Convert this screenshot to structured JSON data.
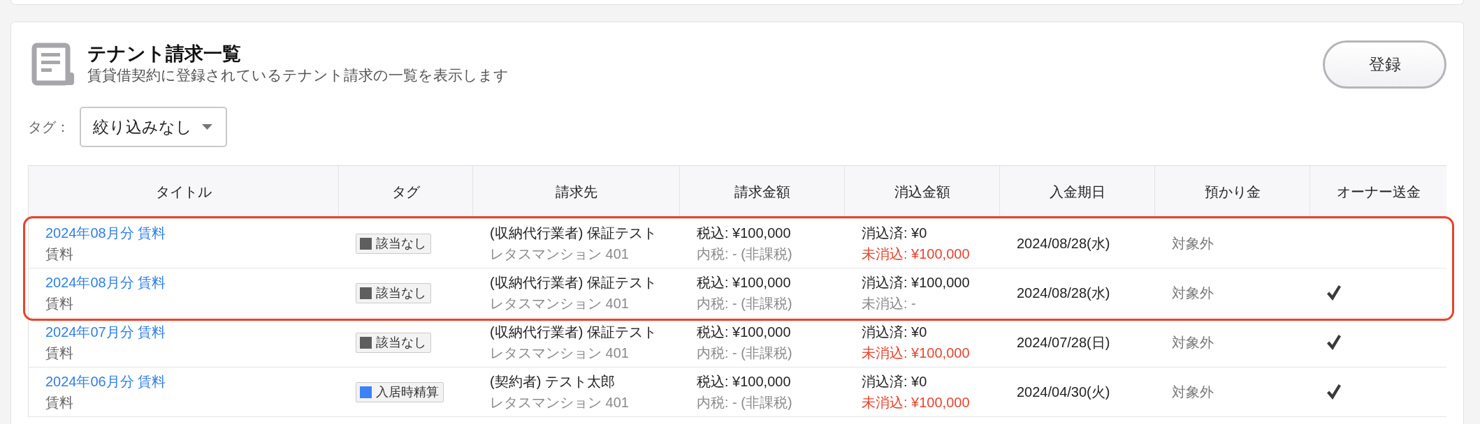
{
  "header": {
    "title": "テナント請求一覧",
    "subtitle": "賃貸借契約に登録されているテナント請求の一覧を表示します",
    "register_button": "登録"
  },
  "filter": {
    "label": "タグ：",
    "value": "絞り込みなし"
  },
  "table": {
    "columns": [
      "タイトル",
      "タグ",
      "請求先",
      "請求金額",
      "消込金額",
      "入金期日",
      "預かり金",
      "オーナー送金"
    ],
    "rows": [
      {
        "title": "2024年08月分 賃料",
        "category": "賃料",
        "tag": {
          "label": "該当なし",
          "color": "#5e5e5e"
        },
        "billing_to": "(収納代行業者) 保証テスト",
        "property": "レタスマンション 401",
        "amount_incl_tax": "税込: ¥100,000",
        "inner_tax": "内税: - (非課税)",
        "cleared": "消込済: ¥0",
        "uncleared": "未消込: ¥100,000",
        "outstanding": true,
        "due_date": "2024/08/28(水)",
        "deposit": "対象外",
        "owner_remitted": false,
        "highlighted": true
      },
      {
        "title": "2024年08月分 賃料",
        "category": "賃料",
        "tag": {
          "label": "該当なし",
          "color": "#5e5e5e"
        },
        "billing_to": "(収納代行業者) 保証テスト",
        "property": "レタスマンション 401",
        "amount_incl_tax": "税込: ¥100,000",
        "inner_tax": "内税: - (非課税)",
        "cleared": "消込済: ¥100,000",
        "uncleared": "未消込: -",
        "outstanding": false,
        "due_date": "2024/08/28(水)",
        "deposit": "対象外",
        "owner_remitted": true,
        "highlighted": true
      },
      {
        "title": "2024年07月分 賃料",
        "category": "賃料",
        "tag": {
          "label": "該当なし",
          "color": "#5e5e5e"
        },
        "billing_to": "(収納代行業者) 保証テスト",
        "property": "レタスマンション 401",
        "amount_incl_tax": "税込: ¥100,000",
        "inner_tax": "内税: - (非課税)",
        "cleared": "消込済: ¥0",
        "uncleared": "未消込: ¥100,000",
        "outstanding": true,
        "due_date": "2024/07/28(日)",
        "deposit": "対象外",
        "owner_remitted": true,
        "highlighted": false
      },
      {
        "title": "2024年06月分 賃料",
        "category": "賃料",
        "tag": {
          "label": "入居時精算",
          "color": "#3b82f6"
        },
        "billing_to": "(契約者) テスト太郎",
        "property": "レタスマンション 401",
        "amount_incl_tax": "税込: ¥100,000",
        "inner_tax": "内税: - (非課税)",
        "cleared": "消込済: ¥0",
        "uncleared": "未消込: ¥100,000",
        "outstanding": true,
        "due_date": "2024/04/30(火)",
        "deposit": "対象外",
        "owner_remitted": true,
        "highlighted": false
      }
    ]
  }
}
